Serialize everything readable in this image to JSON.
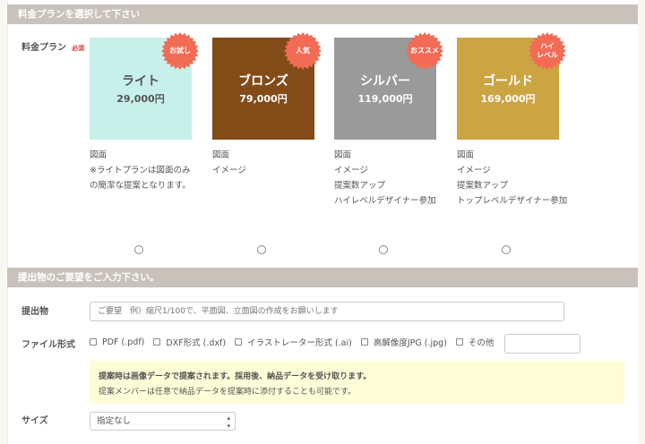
{
  "section1": {
    "title": "料金プランを選択して下さい",
    "label": "料金プラン",
    "required": "必須"
  },
  "plans": [
    {
      "name": "ライト",
      "price": "29,000円",
      "badge": "お試し",
      "color": "#c8f0ea",
      "text_color": "#555",
      "features": [
        "図面",
        "※ライトプランは図面のみの簡潔な提案となります。"
      ]
    },
    {
      "name": "ブロンズ",
      "price": "79,000円",
      "badge": "人気",
      "color": "#824b17",
      "text_color": "#fff",
      "features": [
        "図面",
        "イメージ"
      ]
    },
    {
      "name": "シルバー",
      "price": "119,000円",
      "badge": "おススメ",
      "color": "#9a9a9a",
      "text_color": "#fff",
      "features": [
        "図面",
        "イメージ",
        "提案数アップ",
        "ハイレベルデザイナー参加"
      ]
    },
    {
      "name": "ゴールド",
      "price": "169,000円",
      "badge": "ハイ\nレベル",
      "color": "#cca442",
      "text_color": "#fff",
      "features": [
        "図面",
        "イメージ",
        "提案数アップ",
        "トップレベルデザイナー参加"
      ]
    }
  ],
  "section2": {
    "title": "提出物のご要望をご入力下さい。"
  },
  "deliverable": {
    "label": "提出物",
    "placeholder": "ご要望　例）縮尺1/100で、平面図、立面図の作成をお願いします"
  },
  "file_format": {
    "label": "ファイル形式",
    "options": [
      "PDF (.pdf)",
      "DXF形式 (.dxf)",
      "イラストレーター形式 (.ai)",
      "高解像度JPG (.jpg)",
      "その他"
    ]
  },
  "note": {
    "line1": "提案時は画像データで提案されます。採用後、納品データを受け取ります。",
    "line2": "提案メンバーは任意で納品データを提案時に添付することも可能です。"
  },
  "size": {
    "label": "サイズ",
    "value": "指定なし"
  },
  "badge_color": "#f26b55"
}
